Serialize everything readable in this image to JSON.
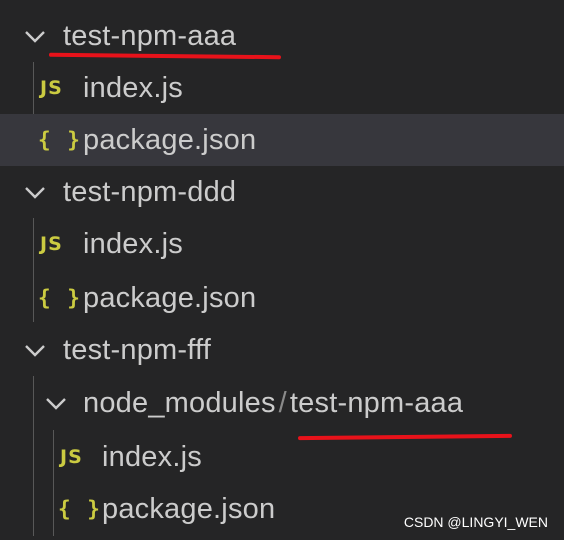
{
  "folders": [
    {
      "name": "test-npm-aaa"
    },
    {
      "name": "test-npm-ddd"
    },
    {
      "name": "test-npm-fff"
    }
  ],
  "nested_folder": {
    "parent": "node_modules",
    "separator": "/",
    "name": "test-npm-aaa"
  },
  "files": {
    "js": "index.js",
    "json": "package.json"
  },
  "icons": {
    "expanded": "chevron-down-icon",
    "js": "JS",
    "json": "{ }"
  },
  "watermark": "CSDN @LINGYI_WEN",
  "colors": {
    "background": "#252526",
    "selected": "#37373d",
    "text": "#cccccc",
    "icon": "#cbcb41",
    "annotation": "#e8121a"
  }
}
